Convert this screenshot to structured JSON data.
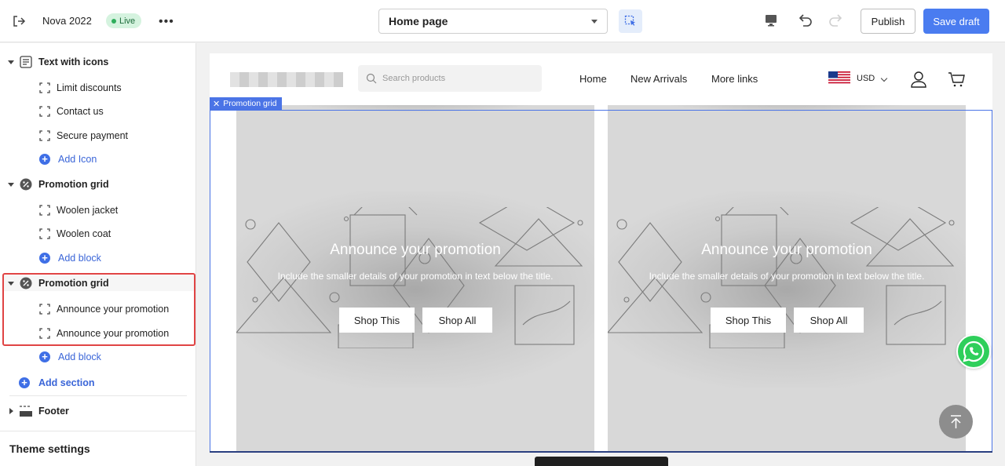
{
  "topbar": {
    "store_name": "Nova 2022",
    "live_badge": "Live",
    "more": "•••",
    "page_select": "Home page",
    "publish": "Publish",
    "save_draft": "Save draft"
  },
  "sidebar": {
    "sections": [
      {
        "label": "Text with icons",
        "icon": "text-icons-icon",
        "blocks": [
          "Limit discounts",
          "Contact us",
          "Secure payment"
        ],
        "add": "Add Icon"
      },
      {
        "label": "Promotion grid",
        "icon": "promotion-percent-icon",
        "blocks": [
          "Woolen jacket",
          "Woolen coat"
        ],
        "add": "Add block"
      },
      {
        "label": "Promotion grid",
        "icon": "promotion-percent-icon",
        "blocks": [
          "Announce your promotion",
          "Announce your promotion"
        ],
        "add": "Add block"
      }
    ],
    "add_section": "Add section",
    "footer": "Footer",
    "theme_settings": "Theme settings"
  },
  "preview": {
    "search_placeholder": "Search products",
    "nav": [
      "Home",
      "New Arrivals",
      "More links"
    ],
    "currency": "USD",
    "section_tag": "Promotion grid",
    "cards": [
      {
        "title": "Announce your promotion",
        "subtitle": "Include the smaller details of your promotion in text below the title.",
        "btn1": "Shop This",
        "btn2": "Shop All"
      },
      {
        "title": "Announce your promotion",
        "subtitle": "Include the smaller details of your promotion in text below the title.",
        "btn1": "Shop This",
        "btn2": "Shop All"
      }
    ]
  },
  "colors": {
    "accent": "#4a7cf0",
    "selection_frame": "#4b74e6",
    "highlight": "#e04444",
    "live_bg": "#d5f3df",
    "whatsapp": "#2fcf5b"
  }
}
